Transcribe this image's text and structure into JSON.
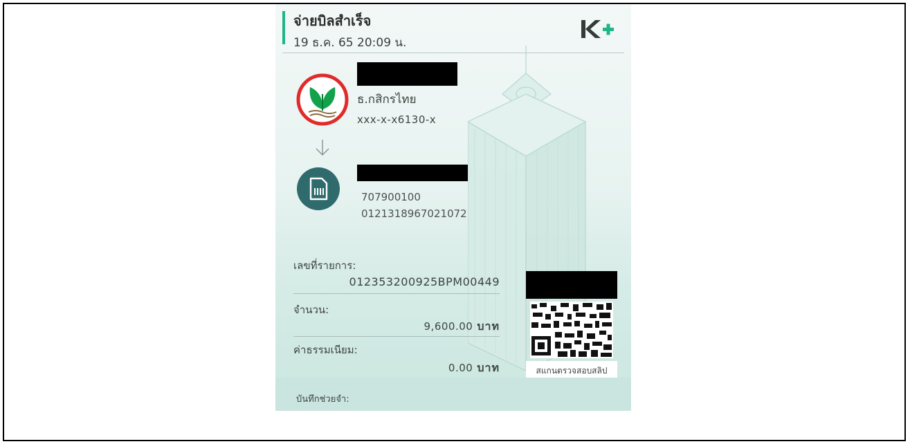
{
  "slip": {
    "title": "จ่ายบิลสำเร็จ",
    "datetime": "19 ธ.ค. 65  20:09 น.",
    "brand_logo": "K+",
    "brand_color": "#21b487"
  },
  "sender": {
    "bank_name": "ธ.กสิกรไทย",
    "account_number": "xxx-x-x6130-x",
    "logo": "kbank-logo"
  },
  "receiver": {
    "line1": "707900100",
    "line2": "0121318967021072",
    "icon": "bill-icon"
  },
  "details": {
    "txn_label": "เลขที่รายการ:",
    "txn_value": "012353200925BPM00449",
    "amount_label": "จำนวน:",
    "amount_value": "9,600.00",
    "amount_unit": "บาท",
    "fee_label": "ค่าธรรมเนียม:",
    "fee_value": "0.00",
    "fee_unit": "บาท"
  },
  "qr": {
    "caption": "สแกนตรวจสอบสลิป"
  },
  "memo": {
    "label": "บันทึกช่วยจำ:"
  }
}
